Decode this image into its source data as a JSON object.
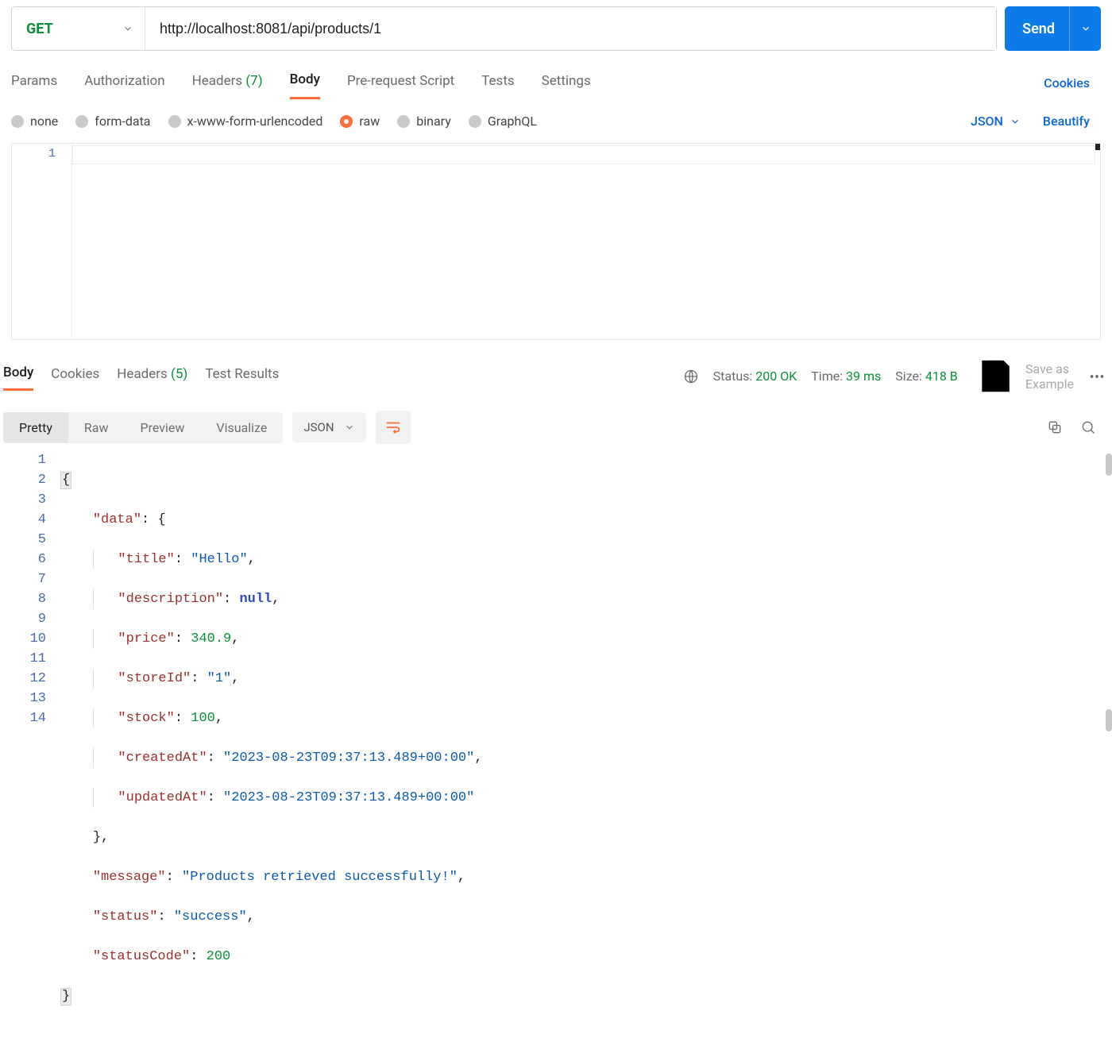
{
  "request": {
    "method": "GET",
    "url": "http://localhost:8081/api/products/1",
    "send_label": "Send"
  },
  "req_tabs": {
    "params": "Params",
    "authorization": "Authorization",
    "headers_label": "Headers",
    "headers_count": "(7)",
    "body": "Body",
    "prerequest": "Pre-request Script",
    "tests": "Tests",
    "settings": "Settings",
    "cookies": "Cookies"
  },
  "body_types": {
    "none": "none",
    "formdata": "form-data",
    "urlencoded": "x-www-form-urlencoded",
    "raw": "raw",
    "binary": "binary",
    "graphql": "GraphQL",
    "json_label": "JSON",
    "beautify": "Beautify"
  },
  "req_editor": {
    "line1": "1"
  },
  "resp_tabs": {
    "body": "Body",
    "cookies": "Cookies",
    "headers_label": "Headers",
    "headers_count": "(5)",
    "tests": "Test Results"
  },
  "resp_status": {
    "status_label": "Status:",
    "status_value": "200 OK",
    "time_label": "Time:",
    "time_value": "39 ms",
    "size_label": "Size:",
    "size_value": "418 B",
    "save_example": "Save as Example"
  },
  "resp_toolbar": {
    "pretty": "Pretty",
    "raw": "Raw",
    "preview": "Preview",
    "visualize": "Visualize",
    "format": "JSON"
  },
  "resp_body_lines": {
    "l1_brace": "{",
    "l2_k": "\"data\"",
    "l2_v": "{",
    "l3_k": "\"title\"",
    "l3_v": "\"Hello\"",
    "l4_k": "\"description\"",
    "l4_v": "null",
    "l5_k": "\"price\"",
    "l5_v": "340.9",
    "l6_k": "\"storeId\"",
    "l6_v": "\"1\"",
    "l7_k": "\"stock\"",
    "l7_v": "100",
    "l8_k": "\"createdAt\"",
    "l8_v": "\"2023-08-23T09:37:13.489+00:00\"",
    "l9_k": "\"updatedAt\"",
    "l9_v": "\"2023-08-23T09:37:13.489+00:00\"",
    "l10_brace": "}",
    "l11_k": "\"message\"",
    "l11_v": "\"Products retrieved successfully!\"",
    "l12_k": "\"status\"",
    "l12_v": "\"success\"",
    "l13_k": "\"statusCode\"",
    "l13_v": "200",
    "l14_brace": "}"
  },
  "gutter": {
    "n1": "1",
    "n2": "2",
    "n3": "3",
    "n4": "4",
    "n5": "5",
    "n6": "6",
    "n7": "7",
    "n8": "8",
    "n9": "9",
    "n10": "10",
    "n11": "11",
    "n12": "12",
    "n13": "13",
    "n14": "14"
  }
}
